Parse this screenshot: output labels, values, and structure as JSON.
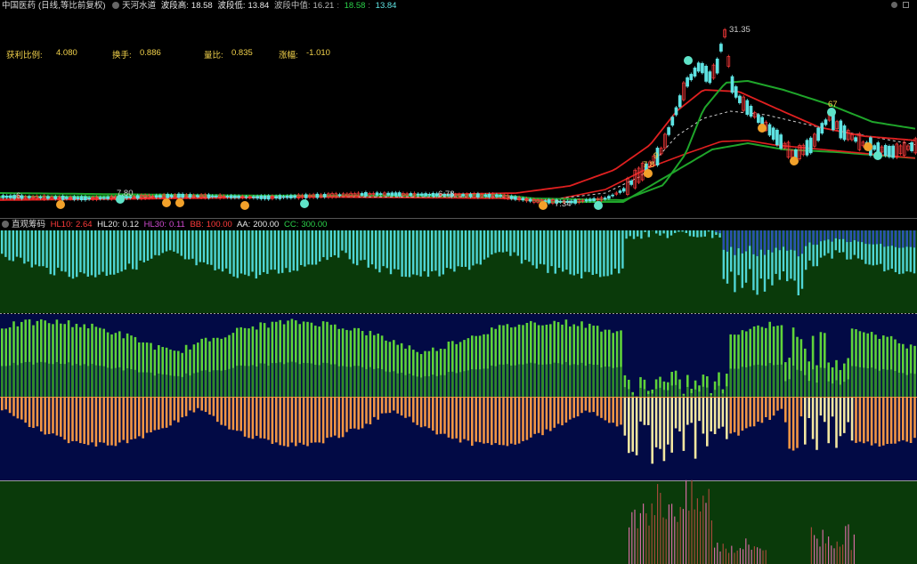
{
  "main_header": {
    "stock_name": "中国医药",
    "period_label": "(日线,等比前复权)",
    "indicator_name": "天河水道",
    "wave_high_label": "波段高:",
    "wave_high_value": "18.58",
    "wave_low_label": "波段低:",
    "wave_low_value": "13.84",
    "wave_mid_label": "波段中值:",
    "wave_mid_value": "16.21",
    "wave_mid_v2": "18.58",
    "wave_mid_v3": "13.84"
  },
  "info_row": {
    "profit_ratio_label": "获利比例:",
    "profit_ratio_value": "4.080",
    "turnover_label": "换手:",
    "turnover_value": "0.886",
    "volume_ratio_label": "量比:",
    "volume_ratio_value": "0.835",
    "change_label": "涨幅:",
    "change_value": "-1.010"
  },
  "price_annotations": {
    "peak": "31.35",
    "low": "7.34",
    "mark_1": "6",
    "mark_2": "7.80",
    "mark_3": "6.78",
    "mark_4": "7.8",
    "mark_5": "9",
    "mark_6": "67"
  },
  "sub_header": {
    "indicator_name": "直观筹码",
    "hl10_label": "HL10:",
    "hl10_value": "2.64",
    "hl20_label": "HL20:",
    "hl20_value": "0.12",
    "hl30_label": "HL30:",
    "hl30_value": "0.11",
    "bb_label": "BB:",
    "bb_value": "100.00",
    "aa_label": "AA:",
    "aa_value": "200.00",
    "cc_label": "CC:",
    "cc_value": "300.00"
  },
  "colors": {
    "bg": "#000000",
    "up": "#ff3b3b",
    "down": "#5fe3e3",
    "ma_red": "#e02020",
    "ma_green": "#1fa52a",
    "label_yellow": "#f2d24b",
    "pane_green_bg": "#0a3a0a",
    "pane_navy_bg": "#020a45"
  }
}
